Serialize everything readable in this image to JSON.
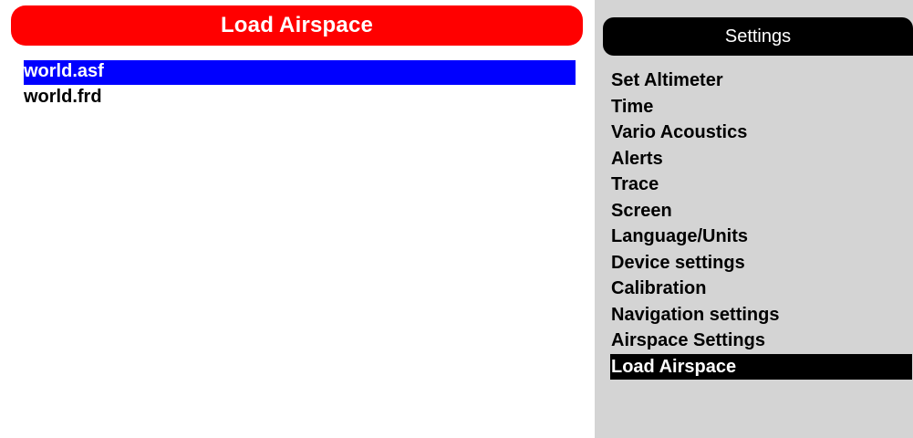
{
  "colors": {
    "title_bar_bg": "#ff0000",
    "selection_bg": "#0000ff",
    "panel_bg": "#d4d4d4",
    "settings_title_bg": "#000000",
    "settings_selection_bg": "#000000"
  },
  "load_airspace": {
    "title": "Load Airspace",
    "files": [
      {
        "label": "world.asf",
        "selected": true
      },
      {
        "label": "world.frd",
        "selected": false
      }
    ]
  },
  "settings": {
    "title": "Settings",
    "items": [
      {
        "label": "Set Altimeter",
        "selected": false
      },
      {
        "label": "Time",
        "selected": false
      },
      {
        "label": "Vario Acoustics",
        "selected": false
      },
      {
        "label": "Alerts",
        "selected": false
      },
      {
        "label": "Trace",
        "selected": false
      },
      {
        "label": "Screen",
        "selected": false
      },
      {
        "label": "Language/Units",
        "selected": false
      },
      {
        "label": "Device settings",
        "selected": false
      },
      {
        "label": "Calibration",
        "selected": false
      },
      {
        "label": "Navigation settings",
        "selected": false
      },
      {
        "label": "Airspace Settings",
        "selected": false
      },
      {
        "label": "Load Airspace",
        "selected": true
      }
    ]
  }
}
